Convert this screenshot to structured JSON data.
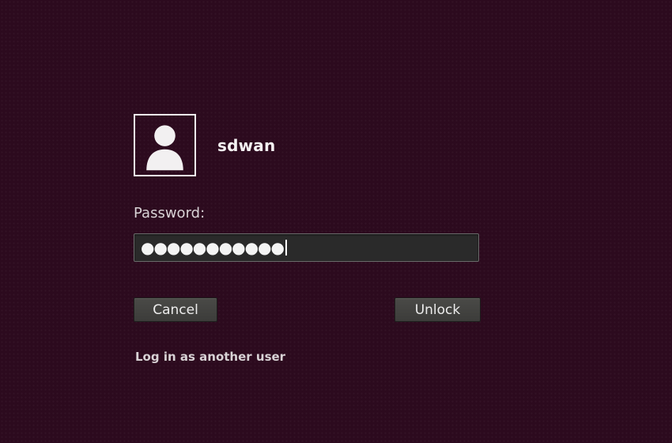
{
  "screen": {
    "background_color": "#2c0a1e"
  },
  "user": {
    "avatar_icon": "user-silhouette-icon",
    "name": "sdwan"
  },
  "password": {
    "label": "Password:",
    "masked_value": "●●●●●●●●●●●",
    "char_count": 11
  },
  "buttons": {
    "cancel_label": "Cancel",
    "unlock_label": "Unlock"
  },
  "links": {
    "switch_user_label": "Log in as another user"
  }
}
